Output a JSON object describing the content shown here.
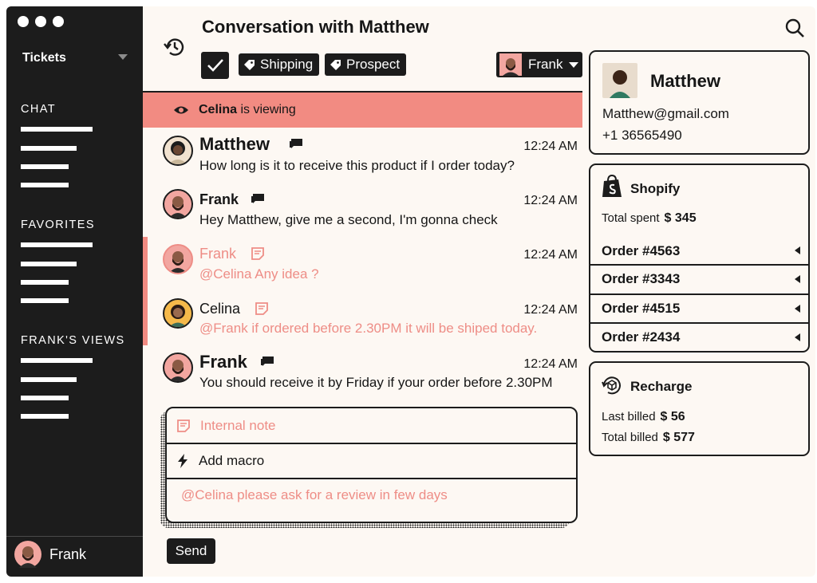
{
  "sidebar": {
    "tickets_label": "Tickets",
    "sections": [
      {
        "title": "CHAT"
      },
      {
        "title": "FAVORITES"
      },
      {
        "title": "FRANK'S VIEWS"
      }
    ],
    "user_name": "Frank"
  },
  "header": {
    "title": "Conversation with Matthew",
    "tags": [
      "Shipping",
      "Prospect"
    ],
    "assignee": "Frank"
  },
  "viewing": {
    "name": "Celina",
    "suffix": "is viewing"
  },
  "messages": [
    {
      "name": "Matthew",
      "time": "12:24 AM",
      "text": "How long is it to receive this product if I order today?",
      "kind": "chat"
    },
    {
      "name": "Frank",
      "time": "12:24 AM",
      "text": "Hey Matthew, give me a second, I'm gonna check",
      "kind": "chat"
    },
    {
      "name": "Frank",
      "time": "12:24 AM",
      "text": "@Celina Any idea ?",
      "kind": "note"
    },
    {
      "name": "Celina",
      "time": "12:24 AM",
      "text": "@Frank if ordered before 2.30PM it will be shiped today.",
      "kind": "note"
    },
    {
      "name": "Frank",
      "time": "12:24 AM",
      "text": "You should receive it by Friday if your order before 2.30PM",
      "kind": "chat"
    }
  ],
  "composer": {
    "internal_note_label": "Internal note",
    "add_macro_label": "Add macro",
    "draft": "@Celina please ask for a review in few days",
    "send_label": "Send"
  },
  "customer": {
    "name": "Matthew",
    "email": "Matthew@gmail.com",
    "phone": "+1 36565490"
  },
  "shopify": {
    "title": "Shopify",
    "total_spent_label": "Total spent",
    "total_spent": "$ 345",
    "orders": [
      "Order #4563",
      "Order #3343",
      "Order #4515",
      "Order #2434"
    ]
  },
  "recharge": {
    "title": "Recharge",
    "last_billed_label": "Last billed",
    "last_billed": "$ 56",
    "total_billed_label": "Total billed",
    "total_billed": "$ 577"
  },
  "colors": {
    "dark": "#1c1c1c",
    "background": "#fdf8f3",
    "accent_pink": "#f28b82",
    "note_text": "#ee8d86"
  },
  "icons": [
    "history-icon",
    "search-icon",
    "check-icon",
    "tag-icon",
    "eye-icon",
    "chat-icon",
    "note-icon",
    "bolt-icon",
    "shopify-icon",
    "recharge-icon"
  ]
}
